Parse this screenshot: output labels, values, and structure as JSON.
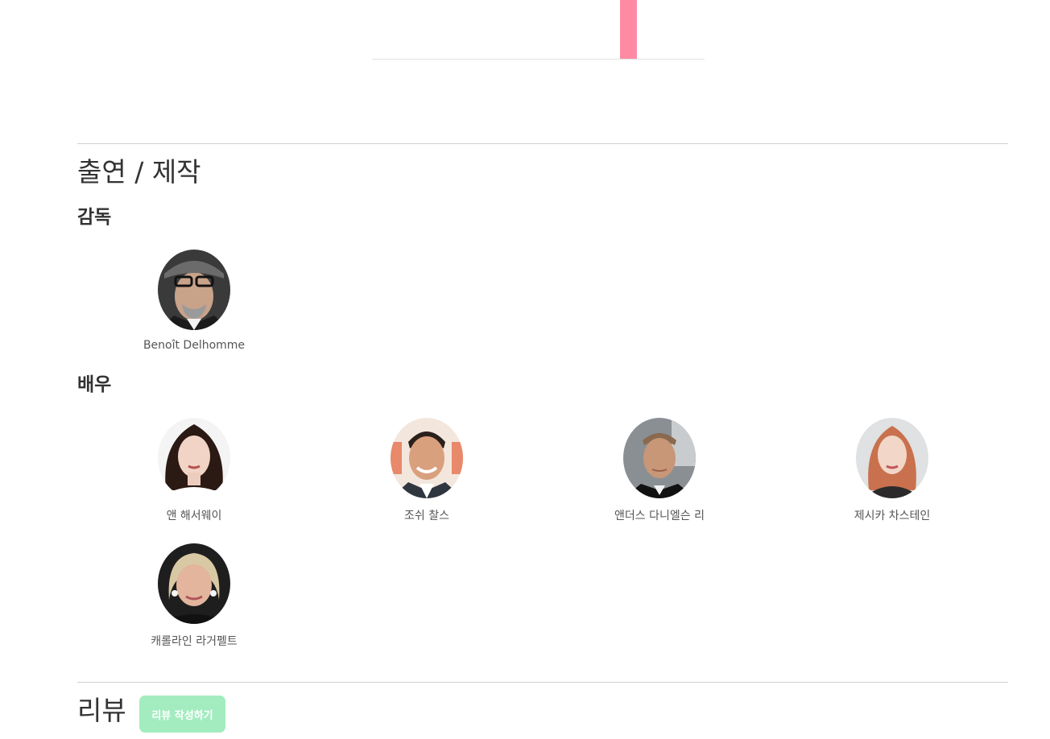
{
  "chart": {
    "bar_color": "#ff8aa4"
  },
  "credits": {
    "title": "출연 / 제작",
    "director_heading": "감독",
    "cast_heading": "배우",
    "directors": [
      {
        "name": "Benoît Delhomme"
      }
    ],
    "cast": [
      {
        "name": "앤 해서웨이"
      },
      {
        "name": "조쉬 찰스"
      },
      {
        "name": "앤더스 다니엘슨 리"
      },
      {
        "name": "제시카 차스테인"
      },
      {
        "name": "캐롤라인 라거펠트"
      }
    ]
  },
  "reviews": {
    "title": "리뷰",
    "write_button_label": "리뷰 작성하기",
    "button_color": "#a3ecc0"
  }
}
